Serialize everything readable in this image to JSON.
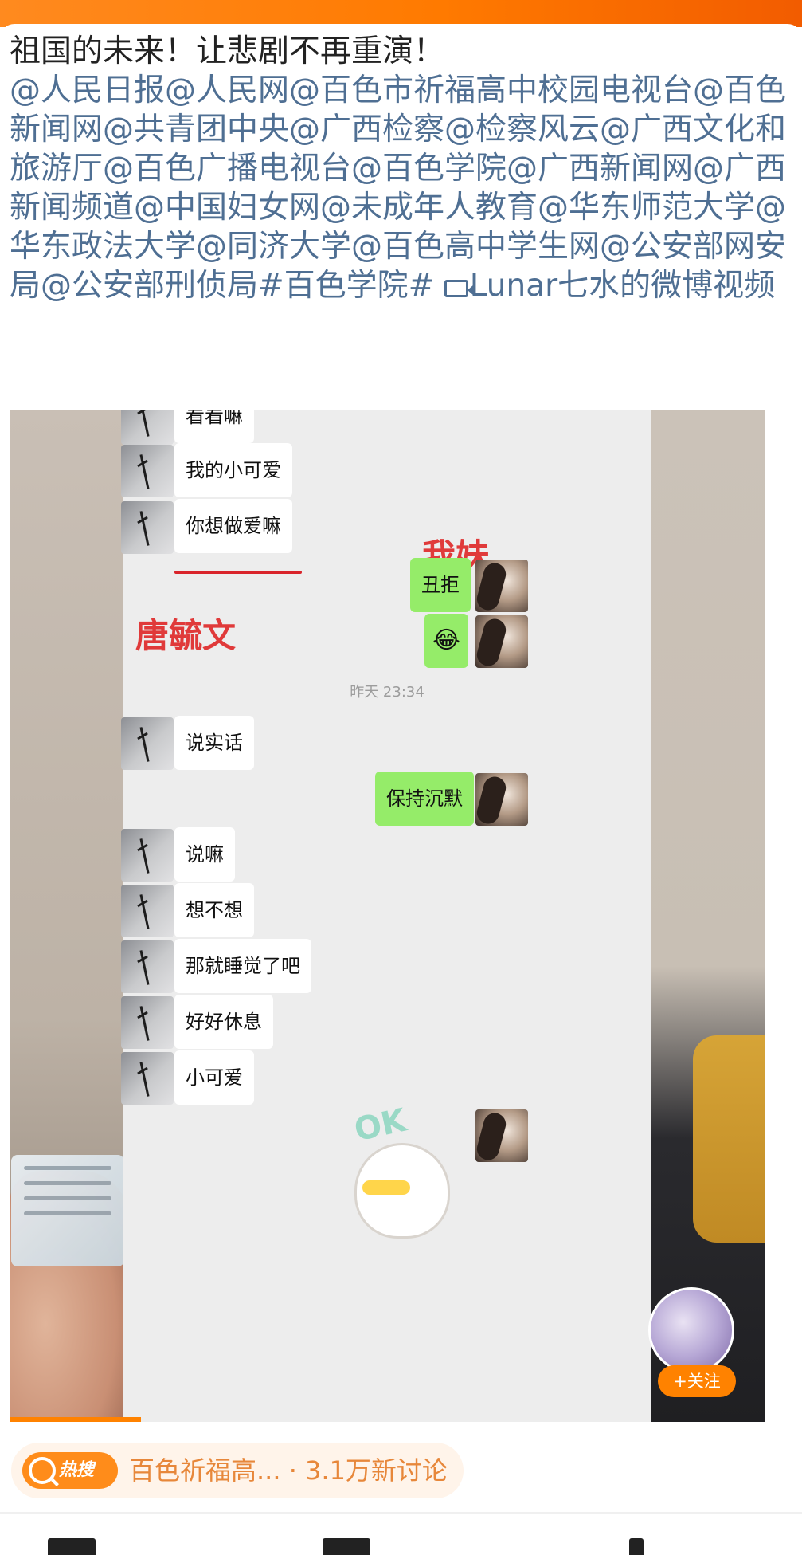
{
  "post": {
    "title": "祖国的未来！让悲剧不再重演！",
    "mentions": "@人民日报@人民网@百色市祈福高中校园电视台@百色新闻网@共青团中央@广西检察@检察风云@广西文化和旅游厅@百色广播电视台@百色学院@广西新闻网@广西新闻频道@中国妇女网@未成年人教育@华东师范大学@华东政法大学@同济大学@百色高中学生网@公安部网安局@公安部刑侦局#百色学院#",
    "video_link": "Lunar七水的微博视频"
  },
  "chat": {
    "messages": [
      {
        "side": "left",
        "text": "看看嘛"
      },
      {
        "side": "left",
        "text": "我的小可爱"
      },
      {
        "side": "left",
        "text": "你想做爱嘛"
      },
      {
        "side": "right",
        "text": "丑拒"
      },
      {
        "side": "right",
        "text": "😂"
      },
      {
        "side": "left",
        "text": "说实话"
      },
      {
        "side": "right",
        "text": "保持沉默"
      },
      {
        "side": "left",
        "text": "说嘛"
      },
      {
        "side": "left",
        "text": "想不想"
      },
      {
        "side": "left",
        "text": "那就睡觉了吧"
      },
      {
        "side": "left",
        "text": "好好休息"
      },
      {
        "side": "left",
        "text": "小可爱"
      }
    ],
    "timestamp": "昨天 23:34",
    "label_sister": "我妹",
    "label_name": "唐毓文",
    "sticker_text": "OK"
  },
  "follow": {
    "label": "+关注"
  },
  "hot_search": {
    "badge": "热搜",
    "text": "百色祈福高... · 3.1万新讨论"
  },
  "colors": {
    "brand_orange": "#ff8200",
    "mention_blue": "#4f6f93",
    "wechat_green": "#95ec69",
    "annotation_red": "#e03a3a"
  },
  "icons": [
    "video-icon",
    "search-icon",
    "avatar"
  ]
}
